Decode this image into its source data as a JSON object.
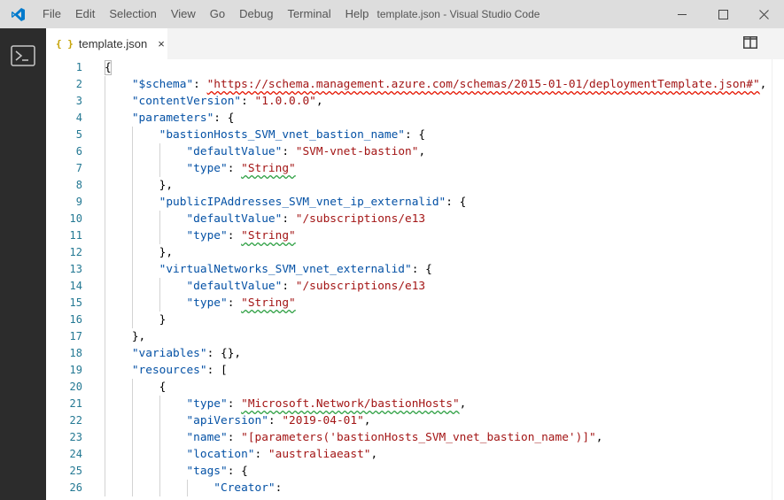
{
  "window": {
    "title": "template.json - Visual Studio Code",
    "menu": [
      "File",
      "Edit",
      "Selection",
      "View",
      "Go",
      "Debug",
      "Terminal",
      "Help"
    ],
    "controls": [
      "minimize-icon",
      "maximize-icon",
      "close-icon"
    ]
  },
  "activity_bar": {
    "items": [
      "terminal-icon"
    ]
  },
  "tabs": [
    {
      "icon": "{ }",
      "label": "template.json",
      "close": "×",
      "active": true
    }
  ],
  "editor": {
    "line_numbers": [
      "1",
      "2",
      "3",
      "4",
      "5",
      "6",
      "7",
      "8",
      "9",
      "10",
      "11",
      "12",
      "13",
      "14",
      "15",
      "16",
      "17",
      "18",
      "19",
      "20",
      "21",
      "22",
      "23",
      "24",
      "25",
      "26"
    ],
    "lines": [
      [
        {
          "c": "p",
          "t": "{"
        }
      ],
      [
        {
          "c": "p",
          "t": "    "
        },
        {
          "c": "k",
          "t": "\"$schema\""
        },
        {
          "c": "p",
          "t": ": "
        },
        {
          "c": "s e",
          "t": "\"https://schema.management.azure.com/schemas/2015-01-01/deploymentTemplate.json#\""
        },
        {
          "c": "p",
          "t": ","
        }
      ],
      [
        {
          "c": "p",
          "t": "    "
        },
        {
          "c": "k",
          "t": "\"contentVersion\""
        },
        {
          "c": "p",
          "t": ": "
        },
        {
          "c": "s",
          "t": "\"1.0.0.0\""
        },
        {
          "c": "p",
          "t": ","
        }
      ],
      [
        {
          "c": "p",
          "t": "    "
        },
        {
          "c": "k",
          "t": "\"parameters\""
        },
        {
          "c": "p",
          "t": ": {"
        }
      ],
      [
        {
          "c": "p",
          "t": "        "
        },
        {
          "c": "k",
          "t": "\"bastionHosts_SVM_vnet_bastion_name\""
        },
        {
          "c": "p",
          "t": ": {"
        }
      ],
      [
        {
          "c": "p",
          "t": "            "
        },
        {
          "c": "k",
          "t": "\"defaultValue\""
        },
        {
          "c": "p",
          "t": ": "
        },
        {
          "c": "s",
          "t": "\"SVM-vnet-bastion\""
        },
        {
          "c": "p",
          "t": ","
        }
      ],
      [
        {
          "c": "p",
          "t": "            "
        },
        {
          "c": "k",
          "t": "\"type\""
        },
        {
          "c": "p",
          "t": ": "
        },
        {
          "c": "s w",
          "t": "\"String\""
        }
      ],
      [
        {
          "c": "p",
          "t": "        },"
        }
      ],
      [
        {
          "c": "p",
          "t": "        "
        },
        {
          "c": "k",
          "t": "\"publicIPAddresses_SVM_vnet_ip_externalid\""
        },
        {
          "c": "p",
          "t": ": {"
        }
      ],
      [
        {
          "c": "p",
          "t": "            "
        },
        {
          "c": "k",
          "t": "\"defaultValue\""
        },
        {
          "c": "p",
          "t": ": "
        },
        {
          "c": "s",
          "t": "\"/subscriptions/e13"
        }
      ],
      [
        {
          "c": "p",
          "t": "            "
        },
        {
          "c": "k",
          "t": "\"type\""
        },
        {
          "c": "p",
          "t": ": "
        },
        {
          "c": "s w",
          "t": "\"String\""
        }
      ],
      [
        {
          "c": "p",
          "t": "        },"
        }
      ],
      [
        {
          "c": "p",
          "t": "        "
        },
        {
          "c": "k",
          "t": "\"virtualNetworks_SVM_vnet_externalid\""
        },
        {
          "c": "p",
          "t": ": {"
        }
      ],
      [
        {
          "c": "p",
          "t": "            "
        },
        {
          "c": "k",
          "t": "\"defaultValue\""
        },
        {
          "c": "p",
          "t": ": "
        },
        {
          "c": "s",
          "t": "\"/subscriptions/e13"
        }
      ],
      [
        {
          "c": "p",
          "t": "            "
        },
        {
          "c": "k",
          "t": "\"type\""
        },
        {
          "c": "p",
          "t": ": "
        },
        {
          "c": "s w",
          "t": "\"String\""
        }
      ],
      [
        {
          "c": "p",
          "t": "        }"
        }
      ],
      [
        {
          "c": "p",
          "t": "    },"
        }
      ],
      [
        {
          "c": "p",
          "t": "    "
        },
        {
          "c": "k",
          "t": "\"variables\""
        },
        {
          "c": "p",
          "t": ": {},"
        }
      ],
      [
        {
          "c": "p",
          "t": "    "
        },
        {
          "c": "k",
          "t": "\"resources\""
        },
        {
          "c": "p",
          "t": ": ["
        }
      ],
      [
        {
          "c": "p",
          "t": "        {"
        }
      ],
      [
        {
          "c": "p",
          "t": "            "
        },
        {
          "c": "k",
          "t": "\"type\""
        },
        {
          "c": "p",
          "t": ": "
        },
        {
          "c": "s w",
          "t": "\"Microsoft.Network/bastionHosts\""
        },
        {
          "c": "p",
          "t": ","
        }
      ],
      [
        {
          "c": "p",
          "t": "            "
        },
        {
          "c": "k",
          "t": "\"apiVersion\""
        },
        {
          "c": "p",
          "t": ": "
        },
        {
          "c": "s",
          "t": "\"2019-04-01\""
        },
        {
          "c": "p",
          "t": ","
        }
      ],
      [
        {
          "c": "p",
          "t": "            "
        },
        {
          "c": "k",
          "t": "\"name\""
        },
        {
          "c": "p",
          "t": ": "
        },
        {
          "c": "s",
          "t": "\"[parameters('bastionHosts_SVM_vnet_bastion_name')]\""
        },
        {
          "c": "p",
          "t": ","
        }
      ],
      [
        {
          "c": "p",
          "t": "            "
        },
        {
          "c": "k",
          "t": "\"location\""
        },
        {
          "c": "p",
          "t": ": "
        },
        {
          "c": "s",
          "t": "\"australiaeast\""
        },
        {
          "c": "p",
          "t": ","
        }
      ],
      [
        {
          "c": "p",
          "t": "            "
        },
        {
          "c": "k",
          "t": "\"tags\""
        },
        {
          "c": "p",
          "t": ": {"
        }
      ],
      [
        {
          "c": "p",
          "t": "                "
        },
        {
          "c": "k",
          "t": "\"Creator\""
        },
        {
          "c": "p",
          "t": ":"
        }
      ]
    ]
  },
  "colors": {
    "titlebar": "#dddddd",
    "activity_bar": "#2c2c2c",
    "key": "#0451a5",
    "string": "#a31515",
    "line_number": "#237893",
    "warning_squiggle": "#2ea043",
    "error_squiggle": "#e51400",
    "logo": "#007acc"
  }
}
